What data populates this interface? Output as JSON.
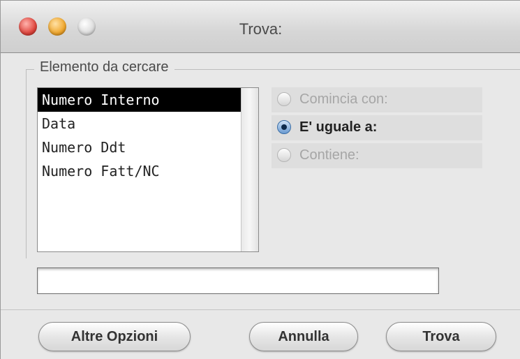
{
  "window": {
    "title": "Trova:"
  },
  "group": {
    "label": "Elemento da cercare"
  },
  "list": {
    "items": [
      "Numero Interno",
      "Data",
      "Numero Ddt",
      "Numero Fatt/NC"
    ],
    "selected_index": 0
  },
  "match_options": {
    "options": [
      {
        "label": "Comincia con:",
        "checked": false,
        "enabled": false
      },
      {
        "label": "E' uguale a:",
        "checked": true,
        "enabled": true
      },
      {
        "label": "Contiene:",
        "checked": false,
        "enabled": false
      }
    ]
  },
  "search": {
    "value": ""
  },
  "buttons": {
    "more_options": "Altre Opzioni",
    "cancel": "Annulla",
    "find": "Trova"
  },
  "colors": {
    "selection": "#000000",
    "radio_accent": "#3b6ea5",
    "close": "#e0463e",
    "minimize": "#f0a72d"
  }
}
